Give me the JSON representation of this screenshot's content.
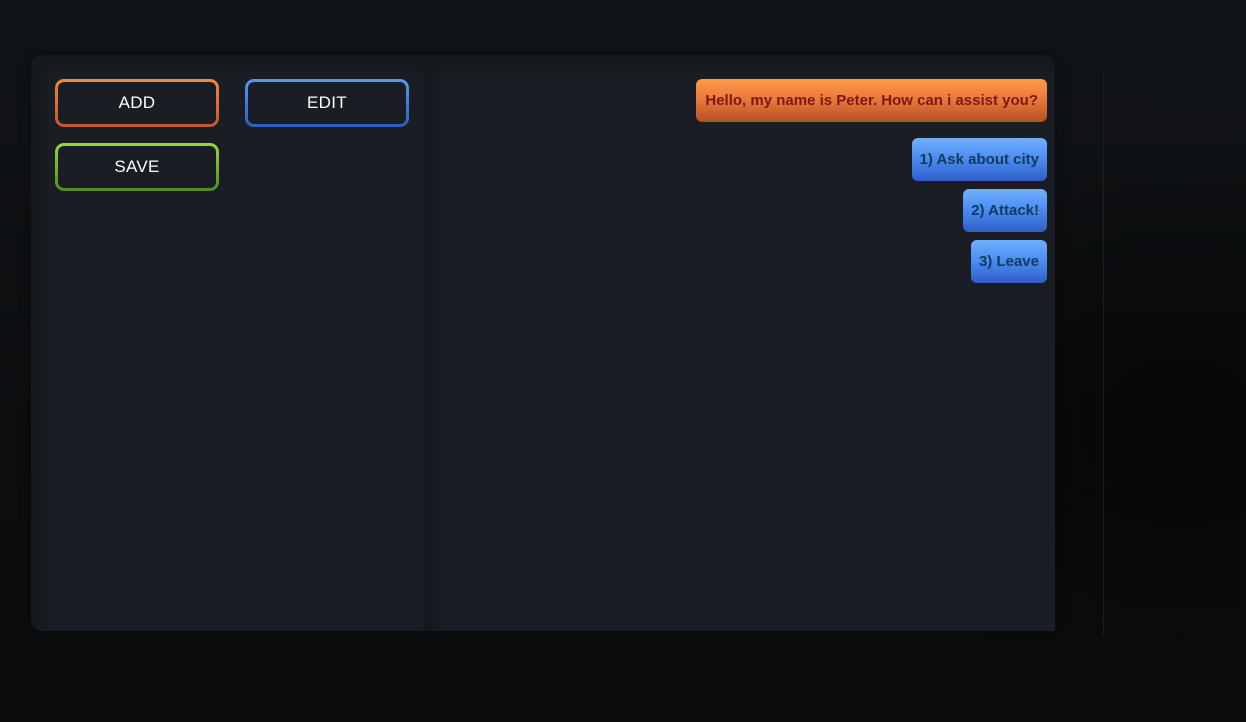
{
  "toolbar": {
    "add_label": "ADD",
    "edit_label": "EDIT",
    "save_label": "SAVE"
  },
  "dialogue": {
    "npc_line": "Hello, my name is Peter. How can i assist you?",
    "options": [
      {
        "label": "1) Ask about city"
      },
      {
        "label": "2) Attack!"
      },
      {
        "label": "3) Leave"
      }
    ]
  },
  "colors": {
    "add_border": "#e0783a",
    "edit_border": "#4a86e8",
    "save_border": "#8cc832",
    "npc_bubble": "#e8763a",
    "option_bubble": "#4a8af0",
    "panel_bg": "#1a1d23"
  }
}
